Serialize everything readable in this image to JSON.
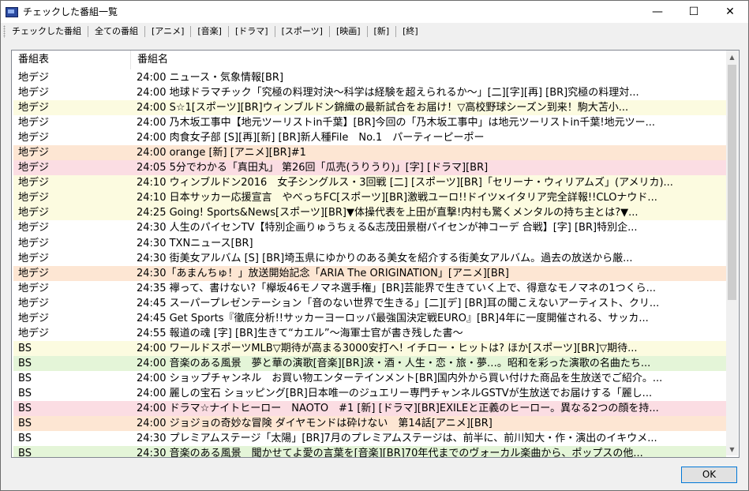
{
  "window": {
    "title": "チェックした番組一覧",
    "controls": {
      "minimize": "—",
      "maximize": "☐",
      "close": "✕"
    }
  },
  "toolbar": {
    "filters": [
      "チェックした番組",
      "全ての番組",
      "[アニメ]",
      "[音楽]",
      "[ドラマ]",
      "[スポーツ]",
      "[映画]",
      "[新]",
      "[終]"
    ]
  },
  "list": {
    "columns": [
      "番組表",
      "番組名"
    ],
    "rows": [
      {
        "channel": "地デジ",
        "program": "24:00 ニュース・気象情報[BR]",
        "color": "none"
      },
      {
        "channel": "地デジ",
        "program": "24:00 地球ドラマチック「究極の料理対決～科学は経験を超えられるか～」[二][字][再] [BR]究極の料理対...",
        "color": "none"
      },
      {
        "channel": "地デジ",
        "program": "24:00 S☆1[スポーツ][BR]ウィンブルドン錦織の最新試合をお届け！▽高校野球シーズン到来！駒大苫小...",
        "color": "yellow"
      },
      {
        "channel": "地デジ",
        "program": "24:00 乃木坂工事中【地元ツーリストin千葉】[BR]今回の「乃木坂工事中」は地元ツーリストin千葉!地元ツー...",
        "color": "none"
      },
      {
        "channel": "地デジ",
        "program": "24:00 肉食女子部 [S][再][新] [BR]新人種File　No.1　パーティーピーポー",
        "color": "none"
      },
      {
        "channel": "地デジ",
        "program": "24:00 orange [新] [アニメ][BR]#1",
        "color": "peach"
      },
      {
        "channel": "地デジ",
        "program": "24:05 5分でわかる「真田丸」 第26回「瓜売(うりうり)」[字] [ドラマ][BR]",
        "color": "pink"
      },
      {
        "channel": "地デジ",
        "program": "24:10 ウィンブルドン2016　女子シングルス・3回戦 [二] [スポーツ][BR]「セリーナ・ウィリアムズ」(アメリカ)...",
        "color": "yellow"
      },
      {
        "channel": "地デジ",
        "program": "24:10 日本サッカー応援宣言　やべっちFC[スポーツ][BR]激戦ユーロ!!ドイツ×イタリア完全詳報!!CLOナウド...",
        "color": "yellow"
      },
      {
        "channel": "地デジ",
        "program": "24:25 Going! Sports&News[スポーツ][BR]▼体操代表を上田が直撃!内村も驚くメンタルの持ち主とは?▼...",
        "color": "yellow"
      },
      {
        "channel": "地デジ",
        "program": "24:30 人生のパイセンTV【特別企画りゅうちぇる&志茂田景樹パイセンが神コーデ 合戦】[字] [BR]特別企...",
        "color": "none"
      },
      {
        "channel": "地デジ",
        "program": "24:30 TXNニュース[BR]",
        "color": "none"
      },
      {
        "channel": "地デジ",
        "program": "24:30 街美女アルバム [S] [BR]埼玉県にゆかりのある美女を紹介する街美女アルバム。過去の放送から厳...",
        "color": "none"
      },
      {
        "channel": "地デジ",
        "program": "24:30「あまんちゅ！」放送開始記念「ARIA The ORIGINATION」[アニメ][BR]",
        "color": "peach"
      },
      {
        "channel": "地デジ",
        "program": "24:35 襷って、書けない?「欅坂46モノマネ選手権」[BR]芸能界で生きていく上で、得意なモノマネの1つくら...",
        "color": "none"
      },
      {
        "channel": "地デジ",
        "program": "24:45 スーパープレゼンテーション「音のない世界で生きる」[二][デ] [BR]耳の聞こえないアーティスト、クリ...",
        "color": "none"
      },
      {
        "channel": "地デジ",
        "program": "24:45 Get Sports『徹底分析!!サッカーヨーロッパ最強国決定戦EURO』[BR]4年に一度開催される、サッカ...",
        "color": "none"
      },
      {
        "channel": "地デジ",
        "program": "24:55 報道の魂 [字] [BR]生きて“カエル”～海軍士官が書き残した書～",
        "color": "none"
      },
      {
        "channel": "BS",
        "program": "24:00 ワールドスポーツMLB▽期待が高まる3000安打へ! イチロー・ヒットは? ほか[スポーツ][BR]▽期待...",
        "color": "yellow"
      },
      {
        "channel": "BS",
        "program": "24:00 音楽のある風景　夢と華の演歌[音楽][BR]涙・酒・人生・恋・旅・夢…。昭和を彩った演歌の名曲たち...",
        "color": "green"
      },
      {
        "channel": "BS",
        "program": "24:00 ショップチャンネル　お買い物エンターテインメント[BR]国内外から買い付けた商品を生放送でご紹介。...",
        "color": "none"
      },
      {
        "channel": "BS",
        "program": "24:00 麗しの宝石 ショッピング[BR]日本唯一のジュエリー専門チャンネルGSTVが生放送でお届けする「麗し...",
        "color": "none"
      },
      {
        "channel": "BS",
        "program": "24:00 ドラマ☆ナイトヒーロー　NAOTO　#1 [新] [ドラマ][BR]EXILEと正義のヒーロー。異なる2つの顔を持...",
        "color": "pink"
      },
      {
        "channel": "BS",
        "program": "24:00 ジョジョの奇妙な冒険 ダイヤモンドは砕けない　第14話[アニメ][BR]",
        "color": "peach"
      },
      {
        "channel": "BS",
        "program": "24:30 プレミアムステージ「太陽」[BR]7月のプレミアムステージは、前半に、前川知大・作・演出のイキウメ...",
        "color": "none"
      },
      {
        "channel": "BS",
        "program": "24:30 音楽のある風景　聞かせてよ愛の言葉を[音楽][BR]70年代までのヴォーカル楽曲から、ポップスの他...",
        "color": "green"
      }
    ]
  },
  "scrollbar": {
    "up": "▲",
    "down": "▼"
  },
  "footer": {
    "ok_label": "OK"
  },
  "colors": {
    "none": "#ffffff",
    "yellow": "#fcfbe0",
    "peach": "#fde6d3",
    "pink": "#fbdde3",
    "green": "#e4f5d8"
  }
}
